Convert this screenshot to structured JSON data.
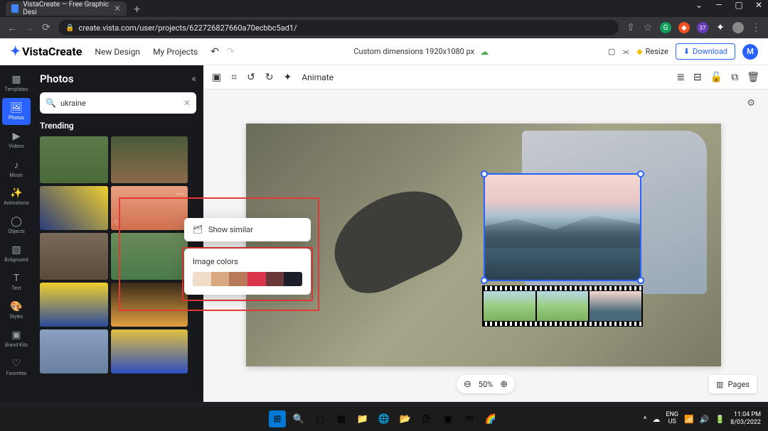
{
  "browser": {
    "tab_title": "VistaCreate — Free Graphic Desi",
    "url": "create.vista.com/user/projects/622726827660a70ecbbc5ad1/",
    "window_controls": {
      "chevron": "⌄",
      "minimize": "—",
      "maximize": "▢",
      "close": "✕"
    }
  },
  "app": {
    "logo_text": "VistaCreate",
    "nav": {
      "new_design": "New Design",
      "my_projects": "My Projects"
    },
    "doc_title": "Custom dimensions 1920x1080 px",
    "resize": "Resize",
    "download": "Download",
    "avatar_letter": "M"
  },
  "rail": {
    "templates": "Templates",
    "photos": "Photos",
    "videos": "Videos",
    "music": "Music",
    "animations": "Animations",
    "objects": "Objects",
    "background": "Bckground",
    "text": "Text",
    "styles": "Styles",
    "brandkits": "Brand Kits",
    "favorites": "Favorites"
  },
  "panel": {
    "title": "Photos",
    "search_value": "ukraine",
    "trending": "Trending"
  },
  "toolbar": {
    "animate": "Animate"
  },
  "popup": {
    "show_similar": "Show similar",
    "annotation": "image colours",
    "image_colors": "Image colors",
    "colors": [
      "#f0dcc8",
      "#d9a880",
      "#b8785a",
      "#d9354a",
      "#6a3838",
      "#1d1f28"
    ]
  },
  "zoom": {
    "level": "50%"
  },
  "pages": {
    "label": "Pages"
  },
  "taskbar": {
    "lang": "ENG",
    "region": "US",
    "time": "11:04 PM",
    "date": "8/03/2022"
  }
}
